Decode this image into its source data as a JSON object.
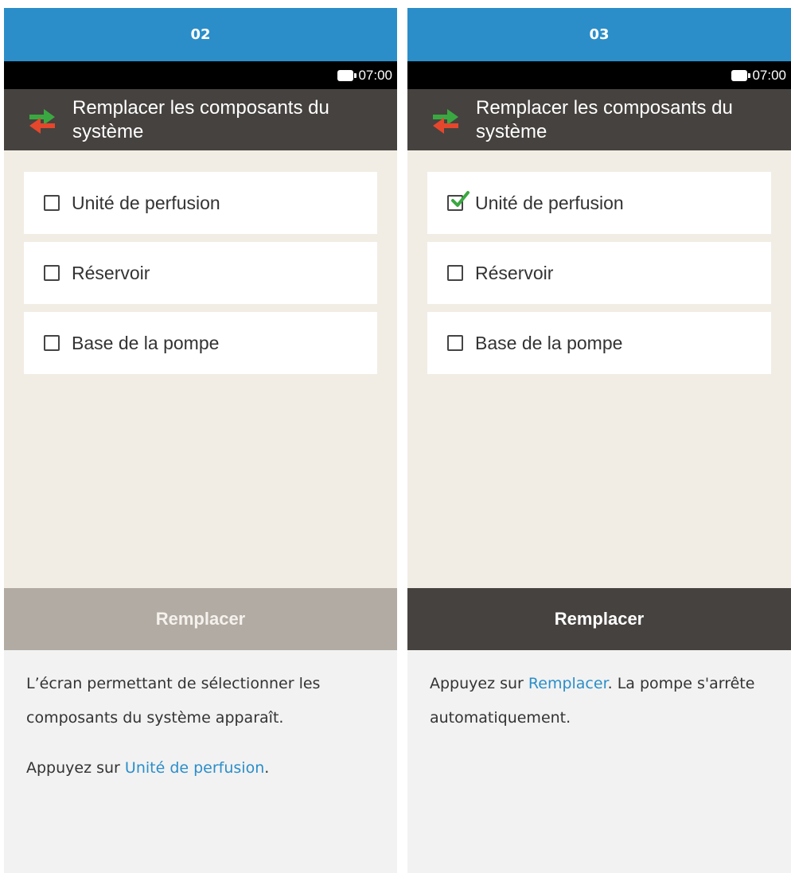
{
  "panels": [
    {
      "step": "02",
      "status": {
        "time": "07:00"
      },
      "title": "Remplacer les composants du système",
      "options": [
        {
          "label": "Unité de perfusion",
          "checked": false
        },
        {
          "label": "Réservoir",
          "checked": false
        },
        {
          "label": "Base de la pompe",
          "checked": false
        }
      ],
      "action": {
        "label": "Remplacer",
        "enabled": false
      },
      "description": {
        "p1": "L’écran permettant de sélectionner les composants du système apparaît.",
        "p2_prefix": "Appuyez sur ",
        "p2_link": "Unité de perfusion",
        "p2_suffix": "."
      }
    },
    {
      "step": "03",
      "status": {
        "time": "07:00"
      },
      "title": "Remplacer les composants du système",
      "options": [
        {
          "label": "Unité de perfusion",
          "checked": true
        },
        {
          "label": "Réservoir",
          "checked": false
        },
        {
          "label": "Base de la pompe",
          "checked": false
        }
      ],
      "action": {
        "label": "Remplacer",
        "enabled": true
      },
      "description": {
        "p1_prefix": "Appuyez sur ",
        "p1_link": "Remplacer",
        "p1_suffix": ". La pompe s'arrête automatiquement."
      }
    }
  ],
  "colors": {
    "step_header": "#2b8ec9",
    "title_bar": "#46423f",
    "screen_bg": "#f1ede4",
    "button_disabled": "#b2aba3",
    "button_enabled": "#46423f",
    "link": "#2b8ec9",
    "arrow_green": "#3aa841",
    "arrow_red": "#e4472c",
    "check_green": "#3aa841"
  },
  "icons": [
    "battery-icon",
    "swap-arrows-icon",
    "checkbox-icon",
    "checkmark-icon"
  ]
}
